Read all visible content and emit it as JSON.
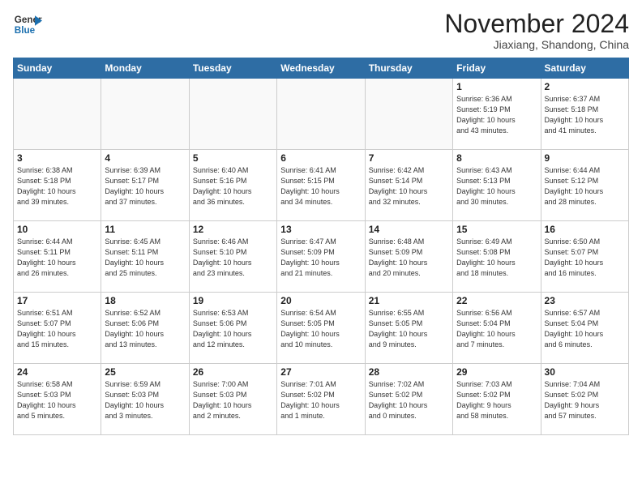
{
  "header": {
    "logo_line1": "General",
    "logo_line2": "Blue",
    "month": "November 2024",
    "location": "Jiaxiang, Shandong, China"
  },
  "weekdays": [
    "Sunday",
    "Monday",
    "Tuesday",
    "Wednesday",
    "Thursday",
    "Friday",
    "Saturday"
  ],
  "weeks": [
    [
      {
        "day": "",
        "info": ""
      },
      {
        "day": "",
        "info": ""
      },
      {
        "day": "",
        "info": ""
      },
      {
        "day": "",
        "info": ""
      },
      {
        "day": "",
        "info": ""
      },
      {
        "day": "1",
        "info": "Sunrise: 6:36 AM\nSunset: 5:19 PM\nDaylight: 10 hours\nand 43 minutes."
      },
      {
        "day": "2",
        "info": "Sunrise: 6:37 AM\nSunset: 5:18 PM\nDaylight: 10 hours\nand 41 minutes."
      }
    ],
    [
      {
        "day": "3",
        "info": "Sunrise: 6:38 AM\nSunset: 5:18 PM\nDaylight: 10 hours\nand 39 minutes."
      },
      {
        "day": "4",
        "info": "Sunrise: 6:39 AM\nSunset: 5:17 PM\nDaylight: 10 hours\nand 37 minutes."
      },
      {
        "day": "5",
        "info": "Sunrise: 6:40 AM\nSunset: 5:16 PM\nDaylight: 10 hours\nand 36 minutes."
      },
      {
        "day": "6",
        "info": "Sunrise: 6:41 AM\nSunset: 5:15 PM\nDaylight: 10 hours\nand 34 minutes."
      },
      {
        "day": "7",
        "info": "Sunrise: 6:42 AM\nSunset: 5:14 PM\nDaylight: 10 hours\nand 32 minutes."
      },
      {
        "day": "8",
        "info": "Sunrise: 6:43 AM\nSunset: 5:13 PM\nDaylight: 10 hours\nand 30 minutes."
      },
      {
        "day": "9",
        "info": "Sunrise: 6:44 AM\nSunset: 5:12 PM\nDaylight: 10 hours\nand 28 minutes."
      }
    ],
    [
      {
        "day": "10",
        "info": "Sunrise: 6:44 AM\nSunset: 5:11 PM\nDaylight: 10 hours\nand 26 minutes."
      },
      {
        "day": "11",
        "info": "Sunrise: 6:45 AM\nSunset: 5:11 PM\nDaylight: 10 hours\nand 25 minutes."
      },
      {
        "day": "12",
        "info": "Sunrise: 6:46 AM\nSunset: 5:10 PM\nDaylight: 10 hours\nand 23 minutes."
      },
      {
        "day": "13",
        "info": "Sunrise: 6:47 AM\nSunset: 5:09 PM\nDaylight: 10 hours\nand 21 minutes."
      },
      {
        "day": "14",
        "info": "Sunrise: 6:48 AM\nSunset: 5:09 PM\nDaylight: 10 hours\nand 20 minutes."
      },
      {
        "day": "15",
        "info": "Sunrise: 6:49 AM\nSunset: 5:08 PM\nDaylight: 10 hours\nand 18 minutes."
      },
      {
        "day": "16",
        "info": "Sunrise: 6:50 AM\nSunset: 5:07 PM\nDaylight: 10 hours\nand 16 minutes."
      }
    ],
    [
      {
        "day": "17",
        "info": "Sunrise: 6:51 AM\nSunset: 5:07 PM\nDaylight: 10 hours\nand 15 minutes."
      },
      {
        "day": "18",
        "info": "Sunrise: 6:52 AM\nSunset: 5:06 PM\nDaylight: 10 hours\nand 13 minutes."
      },
      {
        "day": "19",
        "info": "Sunrise: 6:53 AM\nSunset: 5:06 PM\nDaylight: 10 hours\nand 12 minutes."
      },
      {
        "day": "20",
        "info": "Sunrise: 6:54 AM\nSunset: 5:05 PM\nDaylight: 10 hours\nand 10 minutes."
      },
      {
        "day": "21",
        "info": "Sunrise: 6:55 AM\nSunset: 5:05 PM\nDaylight: 10 hours\nand 9 minutes."
      },
      {
        "day": "22",
        "info": "Sunrise: 6:56 AM\nSunset: 5:04 PM\nDaylight: 10 hours\nand 7 minutes."
      },
      {
        "day": "23",
        "info": "Sunrise: 6:57 AM\nSunset: 5:04 PM\nDaylight: 10 hours\nand 6 minutes."
      }
    ],
    [
      {
        "day": "24",
        "info": "Sunrise: 6:58 AM\nSunset: 5:03 PM\nDaylight: 10 hours\nand 5 minutes."
      },
      {
        "day": "25",
        "info": "Sunrise: 6:59 AM\nSunset: 5:03 PM\nDaylight: 10 hours\nand 3 minutes."
      },
      {
        "day": "26",
        "info": "Sunrise: 7:00 AM\nSunset: 5:03 PM\nDaylight: 10 hours\nand 2 minutes."
      },
      {
        "day": "27",
        "info": "Sunrise: 7:01 AM\nSunset: 5:02 PM\nDaylight: 10 hours\nand 1 minute."
      },
      {
        "day": "28",
        "info": "Sunrise: 7:02 AM\nSunset: 5:02 PM\nDaylight: 10 hours\nand 0 minutes."
      },
      {
        "day": "29",
        "info": "Sunrise: 7:03 AM\nSunset: 5:02 PM\nDaylight: 9 hours\nand 58 minutes."
      },
      {
        "day": "30",
        "info": "Sunrise: 7:04 AM\nSunset: 5:02 PM\nDaylight: 9 hours\nand 57 minutes."
      }
    ]
  ]
}
